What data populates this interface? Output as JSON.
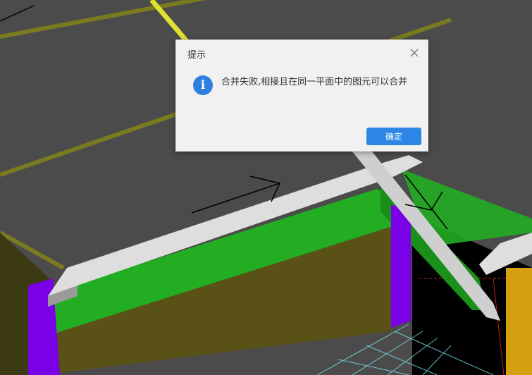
{
  "dialog": {
    "title": "提示",
    "close_icon": "close-icon",
    "info_icon": "info-icon",
    "info_glyph": "i",
    "message": "合并失败,相接且在同一平面中的图元可以合并",
    "ok_label": "确定"
  },
  "colors": {
    "viewport_bg": "#4b4b4b",
    "dialog_bg": "#f1f1f1",
    "accent": "#2d86e5",
    "beam_green": "#22ad22",
    "column_purple": "#7a00e6",
    "wall_olive": "#5a5117",
    "beam_white": "#dedede",
    "axis_yellow": "#e0e030",
    "grid_cyan": "#7fe8f0",
    "column_gold": "#d4a010"
  }
}
